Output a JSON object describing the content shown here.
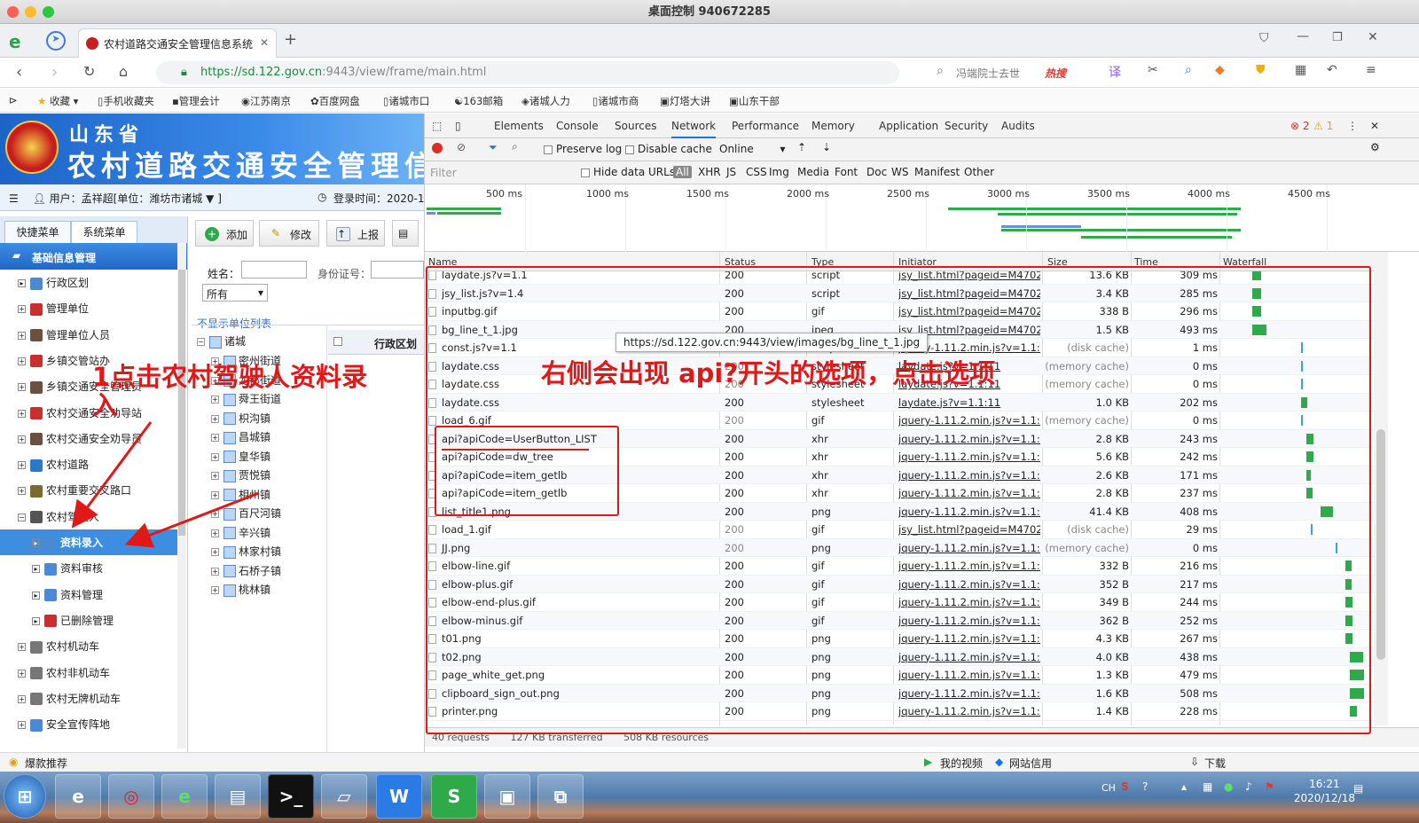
{
  "window": {
    "title": "桌面控制 940672285"
  },
  "browser": {
    "tab_title": "农村道路交通安全管理信息系统",
    "url_host": "https://sd.122.gov.cn",
    "url_rest": ":9443/view/frame/main.html",
    "search_text": "冯端院士去世",
    "hot_label": "热搜",
    "bookmarks": [
      "收藏",
      "手机收藏夹",
      "管理会计",
      "江苏南京",
      "百度网盘",
      "诸城市口",
      "163邮箱",
      "诸城人力",
      "诸城市商",
      "灯塔大讲",
      "山东干部"
    ]
  },
  "app": {
    "banner_province": "山东省",
    "banner_title": "农村道路交通安全管理信息",
    "user_label": "用户：孟祥超[单位：潍坊市诸城",
    "user_suffix": "▼ ]",
    "login_time": "登录时间：2020-1",
    "nav_tabs": [
      "快捷菜单",
      "系统菜单"
    ],
    "nav_group": "基础信息管理",
    "nav_items": [
      {
        "label": "行政区划",
        "pm": "▸"
      },
      {
        "label": "管理单位",
        "pm": "+"
      },
      {
        "label": "管理单位人员",
        "pm": "+"
      },
      {
        "label": "乡镇交管站办",
        "pm": "+"
      },
      {
        "label": "乡镇交通安全管理员",
        "pm": "+"
      },
      {
        "label": "农村交通安全劝导站",
        "pm": "+"
      },
      {
        "label": "农村交通安全劝导员",
        "pm": "+"
      },
      {
        "label": "农村道路",
        "pm": "+"
      },
      {
        "label": "农村重要交叉路口",
        "pm": "+"
      },
      {
        "label": "农村驾驶人",
        "pm": "−"
      },
      {
        "label": "资料录入",
        "pm": "▸",
        "selected": true
      },
      {
        "label": "资料审核",
        "pm": "▸"
      },
      {
        "label": "资料管理",
        "pm": "▸"
      },
      {
        "label": "已删除管理",
        "pm": "▸"
      },
      {
        "label": "农村机动车",
        "pm": "+"
      },
      {
        "label": "农村非机动车",
        "pm": "+"
      },
      {
        "label": "农村无牌机动车",
        "pm": "+"
      },
      {
        "label": "安全宣传阵地",
        "pm": "+"
      }
    ],
    "toolbar": {
      "add": "添加",
      "edit": "修改",
      "report": "上报"
    },
    "form": {
      "name_label": "姓名：",
      "id_label": "身份证号：",
      "select_value": "所有"
    },
    "list_link": "不显示单位列表",
    "tree_root": "诸城",
    "tree_items": [
      "密州街道",
      "龙都街道",
      "舜王街道",
      "枳沟镇",
      "昌城镇",
      "皇华镇",
      "贾悦镇",
      "相州镇",
      "百尺河镇",
      "辛兴镇",
      "林家村镇",
      "石桥子镇",
      "桃林镇"
    ],
    "col_header": "行政区划"
  },
  "devtools": {
    "tabs": [
      "Elements",
      "Console",
      "Sources",
      "Network",
      "Performance",
      "Memory",
      "Application",
      "Security",
      "Audits"
    ],
    "active_tab": "Network",
    "errors": "2",
    "warnings": "1",
    "preserve_log": "Preserve log",
    "disable_cache": "Disable cache",
    "throttle": "Online",
    "filter_placeholder": "Filter",
    "hide_data_urls": "Hide data URLs",
    "filter_types": [
      "All",
      "XHR",
      "JS",
      "CSS",
      "Img",
      "Media",
      "Font",
      "Doc",
      "WS",
      "Manifest",
      "Other"
    ],
    "timeline_ticks": [
      "500 ms",
      "1000 ms",
      "1500 ms",
      "2000 ms",
      "2500 ms",
      "3000 ms",
      "3500 ms",
      "4000 ms",
      "4500 ms"
    ],
    "columns": [
      "Name",
      "Status",
      "Type",
      "Initiator",
      "Size",
      "Time",
      "Waterfall"
    ],
    "rows": [
      {
        "name": "laydate.js?v=1.1",
        "status": "200",
        "type": "script",
        "initiator": "jsy_list.html?pageid=M4702...",
        "size": "13.6 KB",
        "time": "309 ms",
        "wf": 0.66
      },
      {
        "name": "jsy_list.js?v=1.4",
        "status": "200",
        "type": "script",
        "initiator": "jsy_list.html?pageid=M4702...",
        "size": "3.4 KB",
        "time": "285 ms",
        "wf": 0.66
      },
      {
        "name": "inputbg.gif",
        "status": "200",
        "type": "gif",
        "initiator": "jsy_list.html?pageid=M4702...",
        "size": "338 B",
        "time": "296 ms",
        "wf": 0.66
      },
      {
        "name": "bg_line_t_1.jpg",
        "status": "200",
        "type": "jpeg",
        "initiator": "jsy_list.html?pageid=M4702...",
        "size": "1.5 KB",
        "time": "493 ms",
        "wf": 0.66
      },
      {
        "name": "const.js?v=1.1",
        "status": "200",
        "type": "script",
        "initiator": "jquery-1.11.2.min.js?v=1.1:4",
        "size": "(disk cache)",
        "time": "1 ms",
        "wf": 0.76
      },
      {
        "name": "laydate.css",
        "status": "200",
        "type": "stylesheet",
        "initiator": "laydate.js?v=1.1:11",
        "size": "(memory cache)",
        "time": "0 ms",
        "wf": 0.76
      },
      {
        "name": "laydate.css",
        "status": "200",
        "type": "stylesheet",
        "initiator": "laydate.js?v=1.1:11",
        "size": "(memory cache)",
        "time": "0 ms",
        "wf": 0.76
      },
      {
        "name": "laydate.css",
        "status": "200",
        "type": "stylesheet",
        "initiator": "laydate.js?v=1.1:11",
        "size": "1.0 KB",
        "time": "202 ms",
        "wf": 0.76
      },
      {
        "name": "load_6.gif",
        "status": "200",
        "type": "gif",
        "initiator": "jquery-1.11.2.min.js?v=1.1:3",
        "size": "(memory cache)",
        "time": "0 ms",
        "wf": 0.76
      },
      {
        "name": "api?apiCode=UserButton_LIST",
        "status": "200",
        "type": "xhr",
        "initiator": "jquery-1.11.2.min.js?v=1.1:4",
        "size": "2.8 KB",
        "time": "243 ms",
        "wf": 0.77
      },
      {
        "name": "api?apiCode=dw_tree",
        "status": "200",
        "type": "xhr",
        "initiator": "jquery-1.11.2.min.js?v=1.1:4",
        "size": "5.6 KB",
        "time": "242 ms",
        "wf": 0.77
      },
      {
        "name": "api?apiCode=item_getlb",
        "status": "200",
        "type": "xhr",
        "initiator": "jquery-1.11.2.min.js?v=1.1:4",
        "size": "2.6 KB",
        "time": "171 ms",
        "wf": 0.77
      },
      {
        "name": "api?apiCode=item_getlb",
        "status": "200",
        "type": "xhr",
        "initiator": "jquery-1.11.2.min.js?v=1.1:4",
        "size": "2.8 KB",
        "time": "237 ms",
        "wf": 0.77
      },
      {
        "name": "list_title1.png",
        "status": "200",
        "type": "png",
        "initiator": "jquery-1.11.2.min.js?v=1.1:3",
        "size": "41.4 KB",
        "time": "408 ms",
        "wf": 0.8
      },
      {
        "name": "load_1.gif",
        "status": "200",
        "type": "gif",
        "initiator": "jsy_list.html?pageid=M4702...",
        "size": "(disk cache)",
        "time": "29 ms",
        "wf": 0.78
      },
      {
        "name": "JJ.png",
        "status": "200",
        "type": "png",
        "initiator": "jquery-1.11.2.min.js?v=1.1:3",
        "size": "(memory cache)",
        "time": "0 ms",
        "wf": 0.83
      },
      {
        "name": "elbow-line.gif",
        "status": "200",
        "type": "gif",
        "initiator": "jquery-1.11.2.min.js?v=1.1:3",
        "size": "332 B",
        "time": "216 ms",
        "wf": 0.85
      },
      {
        "name": "elbow-plus.gif",
        "status": "200",
        "type": "gif",
        "initiator": "jquery-1.11.2.min.js?v=1.1:3",
        "size": "352 B",
        "time": "217 ms",
        "wf": 0.85
      },
      {
        "name": "elbow-end-plus.gif",
        "status": "200",
        "type": "gif",
        "initiator": "jquery-1.11.2.min.js?v=1.1:3",
        "size": "349 B",
        "time": "244 ms",
        "wf": 0.85
      },
      {
        "name": "elbow-minus.gif",
        "status": "200",
        "type": "gif",
        "initiator": "jquery-1.11.2.min.js?v=1.1:4",
        "size": "362 B",
        "time": "252 ms",
        "wf": 0.85
      },
      {
        "name": "t01.png",
        "status": "200",
        "type": "png",
        "initiator": "jquery-1.11.2.min.js?v=1.1:3",
        "size": "4.3 KB",
        "time": "267 ms",
        "wf": 0.85
      },
      {
        "name": "t02.png",
        "status": "200",
        "type": "png",
        "initiator": "jquery-1.11.2.min.js?v=1.1:3",
        "size": "4.0 KB",
        "time": "438 ms",
        "wf": 0.86
      },
      {
        "name": "page_white_get.png",
        "status": "200",
        "type": "png",
        "initiator": "jquery-1.11.2.min.js?v=1.1:3",
        "size": "1.3 KB",
        "time": "479 ms",
        "wf": 0.86
      },
      {
        "name": "clipboard_sign_out.png",
        "status": "200",
        "type": "png",
        "initiator": "jquery-1.11.2.min.js?v=1.1:3",
        "size": "1.6 KB",
        "time": "508 ms",
        "wf": 0.86
      },
      {
        "name": "printer.png",
        "status": "200",
        "type": "png",
        "initiator": "jquery-1.11.2.min.js?v=1.1:3",
        "size": "1.4 KB",
        "time": "228 ms",
        "wf": 0.86
      }
    ],
    "footer": {
      "requests": "40 requests",
      "transferred": "127 KB transferred",
      "resources": "508 KB resources"
    },
    "tooltip": "https://sd.122.gov.cn:9443/view/images/bg_line_t_1.jpg"
  },
  "annotations": {
    "left_line1": "1点击农村驾驶人资料录",
    "left_line2": "入",
    "right": "右侧会出现 api?开头的选项，点击选项",
    "color": "#e01818"
  },
  "statusbar": {
    "left": "爆款推荐",
    "video": "我的视频",
    "app": "网站信用",
    "download": "下载"
  },
  "taskbar": {
    "time": "16:21",
    "date": "2020/12/18",
    "ime": "CH"
  }
}
